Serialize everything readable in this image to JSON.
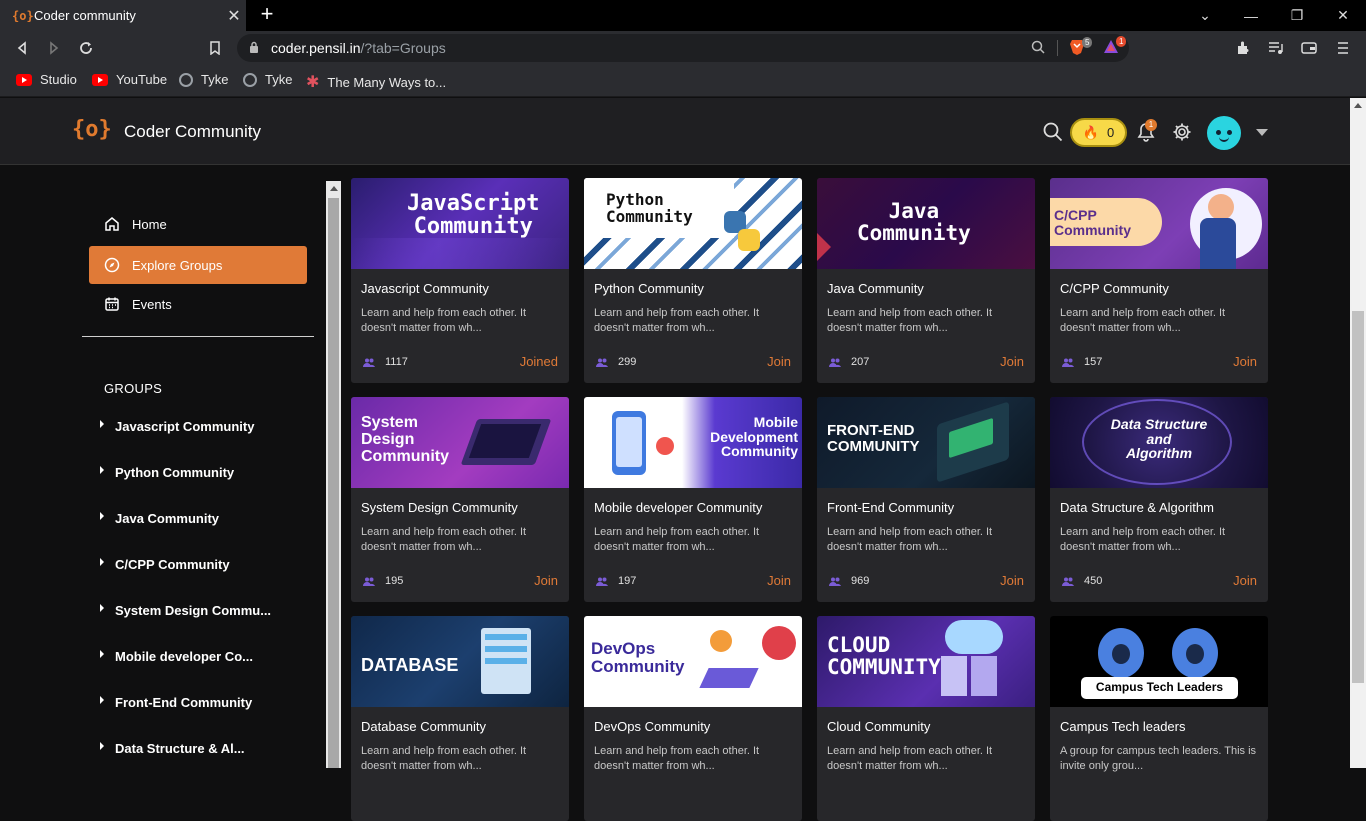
{
  "browser": {
    "tab_title": "Coder community",
    "tab_favicon": "{o}",
    "url_host": "coder.pensil.in",
    "url_path": "/?tab=Groups",
    "brave_badge": "5",
    "rewards_badge": "1",
    "bookmarks": [
      {
        "label": "Studio",
        "icon": "youtube-icon"
      },
      {
        "label": "YouTube",
        "icon": "youtube-icon"
      },
      {
        "label": "Tyke",
        "icon": "globe-icon"
      },
      {
        "label": "Tyke",
        "icon": "globe-icon"
      },
      {
        "label": "The Many Ways to...",
        "icon": "asterisk-icon"
      }
    ]
  },
  "header": {
    "logo": "{o}",
    "brand": "Coder Community",
    "coins": "0",
    "notifications": "1"
  },
  "sidebar": {
    "nav": [
      {
        "label": "Home",
        "icon": "home-icon"
      },
      {
        "label": "Explore Groups",
        "icon": "compass-icon",
        "active": true
      },
      {
        "label": "Events",
        "icon": "calendar-icon"
      }
    ],
    "groups_title": "GROUPS",
    "groups": [
      "Javascript Community",
      "Python Community",
      "Java Community",
      "C/CPP Community",
      "System Design Commu...",
      "Mobile developer Co...",
      "Front-End Community",
      "Data Structure & Al..."
    ]
  },
  "cards": [
    {
      "banner": "JavaScript\nCommunity",
      "title": "Javascript Community",
      "desc": "Learn and help from each other. It doesn't matter from wh...",
      "members": "1117",
      "status": "Joined"
    },
    {
      "banner": "Python\nCommunity",
      "title": "Python Community",
      "desc": "Learn and help from each other. It doesn't matter from wh...",
      "members": "299",
      "status": "Join"
    },
    {
      "banner": "Java\nCommunity",
      "title": "Java Community",
      "desc": "Learn and help from each other. It doesn't matter from wh...",
      "members": "207",
      "status": "Join"
    },
    {
      "banner": "C/CPP\nCommunity",
      "title": "C/CPP Community",
      "desc": "Learn and help from each other. It doesn't matter from wh...",
      "members": "157",
      "status": "Join"
    },
    {
      "banner": "System\nDesign\nCommunity",
      "title": "System Design Community",
      "desc": "Learn and help from each other. It doesn't matter from wh...",
      "members": "195",
      "status": "Join"
    },
    {
      "banner": "Mobile\nDevelopment\nCommunity",
      "title": "Mobile developer Community",
      "desc": "Learn and help from each other. It doesn't matter from wh...",
      "members": "197",
      "status": "Join"
    },
    {
      "banner": "FRONT-END\nCOMMUNITY",
      "title": "Front-End Community",
      "desc": "Learn and help from each other. It doesn't matter from wh...",
      "members": "969",
      "status": "Join"
    },
    {
      "banner": "Data Structure\nand\nAlgorithm",
      "title": "Data Structure & Algorithm",
      "desc": "Learn and help from each other. It doesn't matter from wh...",
      "members": "450",
      "status": "Join"
    },
    {
      "banner": "DATABASE",
      "title": "Database Community",
      "desc": "Learn and help from each other. It doesn't matter from wh...",
      "members": "",
      "status": ""
    },
    {
      "banner": "DevOps\nCommunity",
      "title": "DevOps Community",
      "desc": "Learn and help from each other. It doesn't matter from wh...",
      "members": "",
      "status": ""
    },
    {
      "banner": "CLOUD\nCOMMUNITY",
      "title": "Cloud Community",
      "desc": "Learn and help from each other. It doesn't matter from wh...",
      "members": "",
      "status": ""
    },
    {
      "banner": "Campus Tech Leaders",
      "title": "Campus Tech leaders",
      "desc": "A group for campus tech leaders. This is invite only grou...",
      "members": "",
      "status": ""
    }
  ],
  "colors": {
    "accent": "#e07a37",
    "bg": "#0f0f10",
    "card": "#27272a",
    "header": "#1f1f22"
  }
}
